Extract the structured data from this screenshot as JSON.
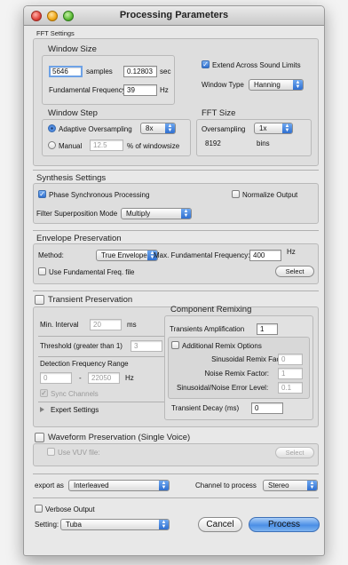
{
  "window": {
    "title": "Processing Parameters"
  },
  "fft": {
    "section_title": "FFT Settings",
    "window_size_title": "Window Size",
    "samples_value": "5646",
    "samples_label": "samples",
    "sec_value": "0.12803",
    "sec_label": "sec",
    "fund_freq_label": "Fundamental Frequency",
    "fund_freq_value": "39",
    "hz_label": "Hz",
    "extend_label": "Extend Across Sound Limits",
    "window_type_label": "Window Type",
    "window_type_value": "Hanning",
    "window_step_title": "Window Step",
    "adaptive_label": "Adaptive Oversampling",
    "adaptive_value": "8x",
    "manual_label": "Manual",
    "manual_value": "12.5",
    "manual_unit": "% of windowsize",
    "fft_size_title": "FFT Size",
    "oversampling_label": "Oversampling",
    "oversampling_value": "1x",
    "bins_value": "8192",
    "bins_label": "bins"
  },
  "synthesis": {
    "section_title": "Synthesis Settings",
    "phase_label": "Phase Synchronous Processing",
    "normalize_label": "Normalize Output",
    "filter_mode_label": "Filter Superposition Mode",
    "filter_mode_value": "Multiply"
  },
  "envelope": {
    "section_title": "Envelope Preservation",
    "method_label": "Method:",
    "method_value": "True Envelope",
    "max_freq_label": "Max. Fundamental Frequency:",
    "max_freq_value": "400",
    "hz_label": "Hz",
    "use_file_label": "Use Fundamental Freq. file",
    "select_label": "Select"
  },
  "transient": {
    "section_title": "Transient Preservation",
    "min_interval_label": "Min. Interval",
    "min_interval_value": "20",
    "ms_label": "ms",
    "threshold_label": "Threshold (greater than 1)",
    "threshold_value": "3",
    "detection_label": "Detection Frequency Range",
    "range_low": "0",
    "range_dash": "-",
    "range_high": "22050",
    "hz_label": "Hz",
    "sync_label": "Sync Channels",
    "expert_label": "Expert Settings"
  },
  "remix": {
    "section_title": "Component Remixing",
    "transients_amp_label": "Transients Amplification",
    "transients_amp_value": "1",
    "additional_label": "Additional Remix Options",
    "sinusoidal_label": "Sinusoidal Remix Factor:",
    "sinusoidal_value": "0",
    "noise_label": "Noise Remix Factor:",
    "noise_value": "1",
    "ratio_label": "Sinusoidal/Noise Error Level:",
    "ratio_value": "0.1",
    "decay_label": "Transient Decay (ms)",
    "decay_value": "0"
  },
  "waveform": {
    "section_title": "Waveform Preservation (Single Voice)",
    "vuv_label": "Use VUV file:",
    "select_label": "Select"
  },
  "footer": {
    "export_label": "export as",
    "export_value": "Interleaved",
    "channel_label": "Channel to process",
    "channel_value": "Stereo",
    "verbose_label": "Verbose Output",
    "setting_label": "Setting:",
    "setting_value": "Tuba",
    "cancel_label": "Cancel",
    "process_label": "Process"
  }
}
